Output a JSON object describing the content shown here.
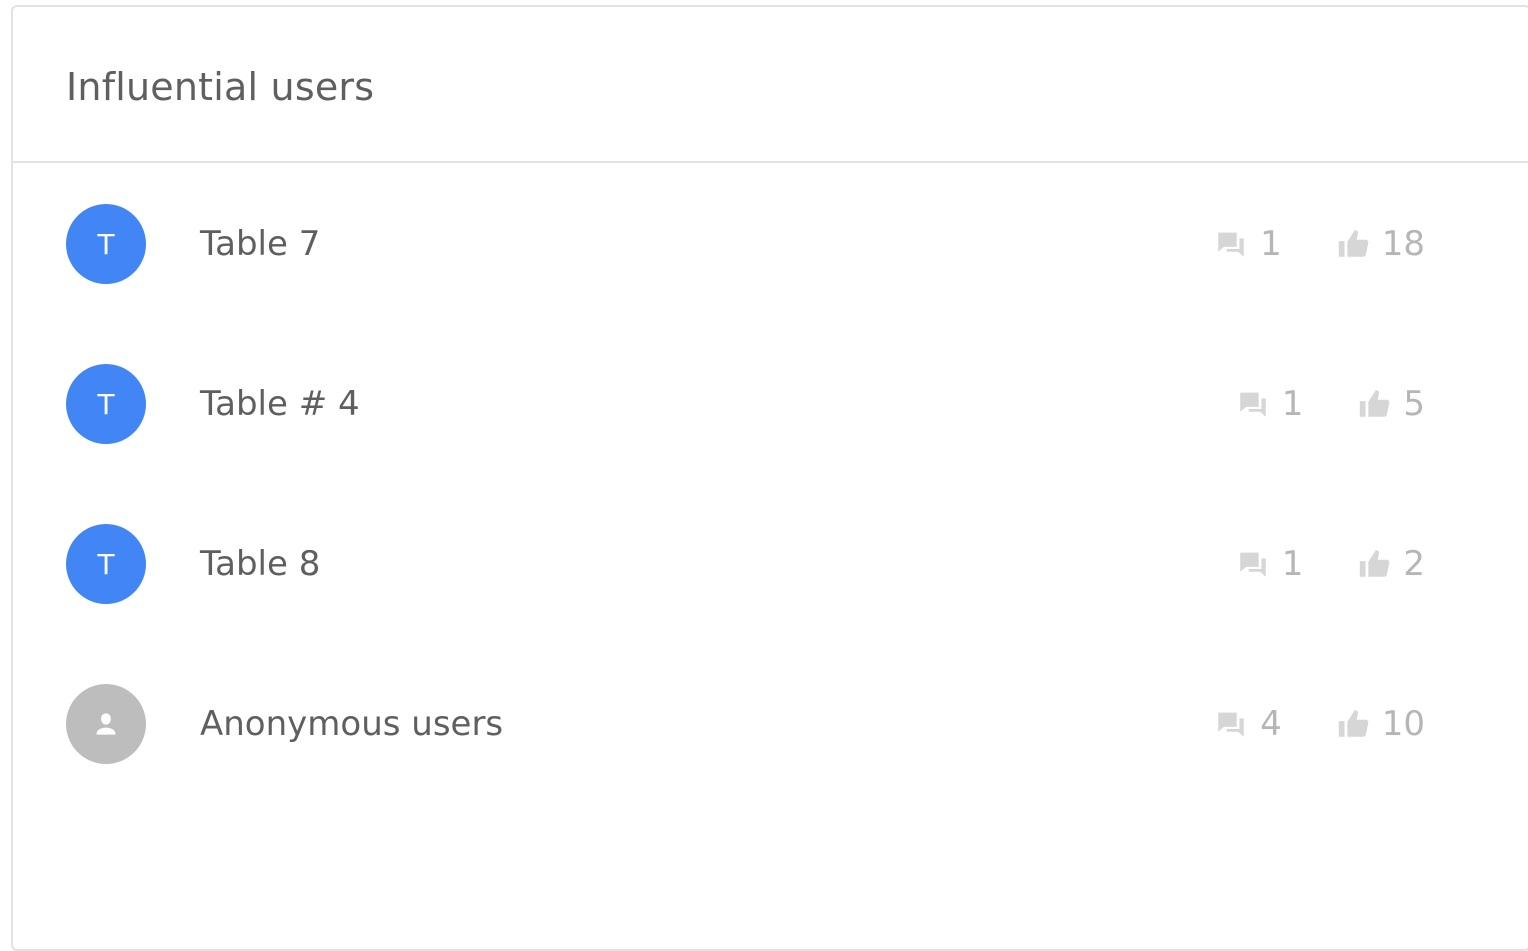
{
  "widget": {
    "title": "Influential users"
  },
  "colors": {
    "avatar_blue": "#4285f4",
    "avatar_gray": "#bdbdbd",
    "text": "#5f5f5f",
    "stat_text": "#b6b6b6",
    "icon": "#d6d6d6"
  },
  "users": [
    {
      "initial": "T",
      "name": "Table 7",
      "comments": "1",
      "likes": "18",
      "avatar_type": "initial"
    },
    {
      "initial": "T",
      "name": "Table # 4",
      "comments": "1",
      "likes": "5",
      "avatar_type": "initial"
    },
    {
      "initial": "T",
      "name": "Table 8",
      "comments": "1",
      "likes": "2",
      "avatar_type": "initial"
    },
    {
      "initial": "",
      "name": "Anonymous users",
      "comments": "4",
      "likes": "10",
      "avatar_type": "anonymous"
    }
  ],
  "icons": {
    "comments": "comments-icon",
    "likes": "thumbs-up-icon",
    "anonymous": "person-icon"
  }
}
